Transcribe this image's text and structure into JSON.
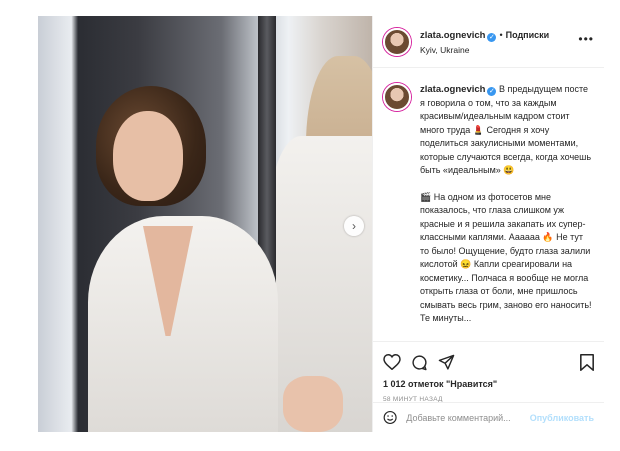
{
  "post": {
    "username": "zlata.ognevich",
    "follow_label": "Подписки",
    "separator": "•",
    "location": "Kyiv, Ukraine",
    "more_icon": "more-horizontal-icon",
    "caption": {
      "paragraph_1": "В предыдущем посте я говорила о том, что за каждым красивым/идеальным кадром стоит много труда 💄 Сегодня я хочу поделиться закулисными моментами, которые случаются всегда, когда хочешь быть «идеальным» 😃",
      "paragraph_2": "🎬 На одном из фотосетов мне показалось, что глаза слишком уж красные и я решила закапать их супер-классными каплями. Аааааа 🔥 Не тут то было! Ощущение, будто глаза залили кислотой 😖 Капли среагировали на косметику... Полчаса я вообще не могла открыть глаза от боли, мне пришлось смывать весь грим, заново его наносить! Те минуты..."
    },
    "likes": "1 012 отметок \"Нравится\"",
    "time": "58 МИНУТ НАЗАД",
    "comment_placeholder": "Добавьте комментарий...",
    "publish_label": "Опубликовать",
    "carousel": {
      "slides": 2,
      "active": 1
    }
  },
  "icons": {
    "like": "heart-icon",
    "comment": "comment-icon",
    "share": "share-icon",
    "save": "bookmark-icon",
    "emoji": "smile-icon",
    "next": "chevron-right-icon"
  },
  "colors": {
    "accent": "#3897f0",
    "publish_disabled": "#b2dffc",
    "muted": "#8e8e8e",
    "text": "#262626"
  }
}
